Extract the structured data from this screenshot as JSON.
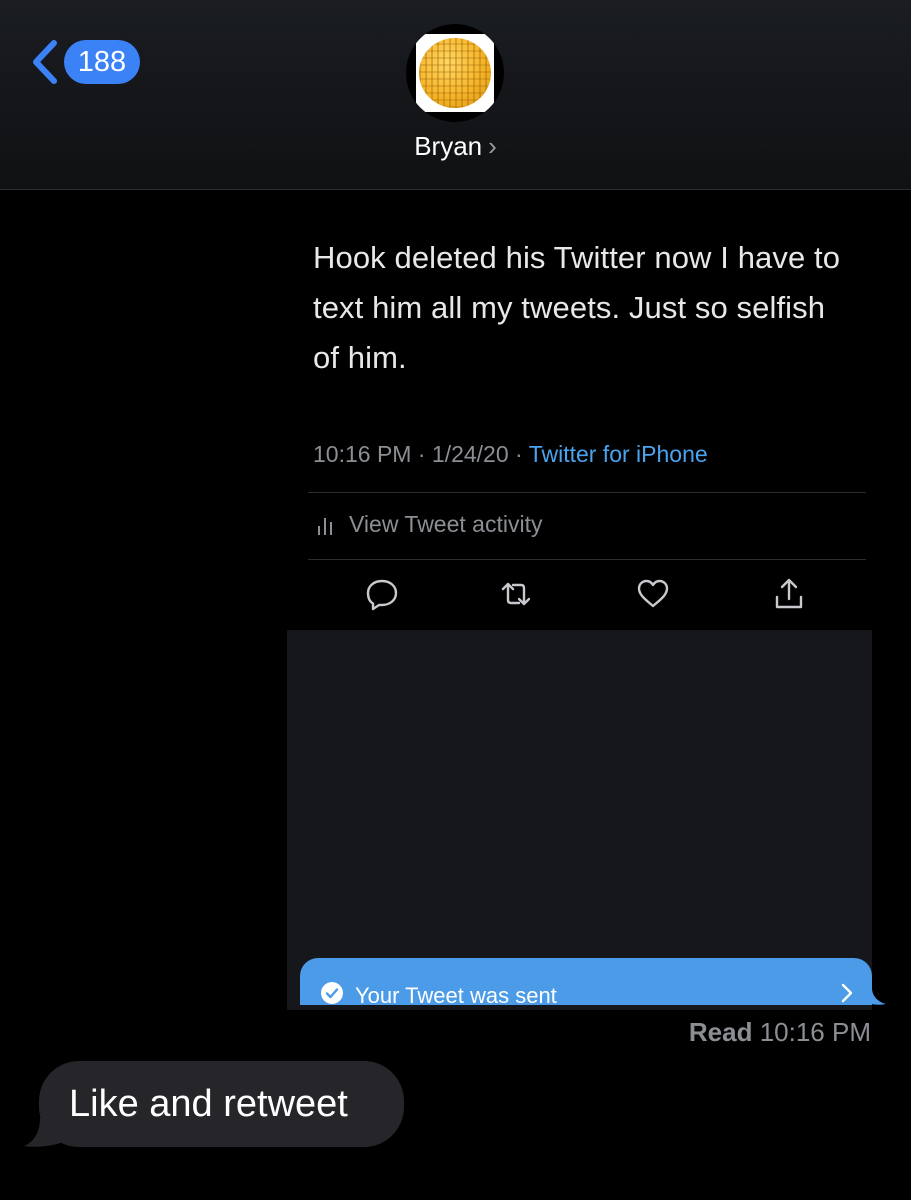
{
  "header": {
    "back_count": "188",
    "contact_name": "Bryan",
    "contact_chevron": "›"
  },
  "tweet": {
    "text": "Hook deleted his Twitter now I have to text him all my tweets.  Just so selfish of him.",
    "time": "10:16 PM",
    "date": "1/24/20",
    "source": "Twitter for iPhone",
    "activity_label": "View Tweet activity",
    "toast_label": "Your Tweet was sent"
  },
  "receipt": {
    "status": "Read",
    "time": "10:16 PM"
  },
  "incoming": {
    "text": "Like and retweet"
  },
  "colors": {
    "accent": "#3b82f6",
    "twitter_blue": "#4aa3ee",
    "toast_blue": "#4b9be8",
    "incoming_bubble": "#26262a"
  },
  "icons": [
    "chevron-left-icon",
    "reply-icon",
    "retweet-icon",
    "like-icon",
    "share-icon",
    "activity-bars-icon",
    "check-circle-icon",
    "chevron-right-icon"
  ]
}
